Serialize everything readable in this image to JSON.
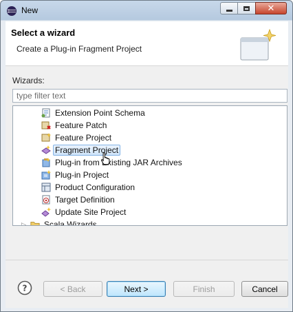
{
  "window": {
    "title": "New"
  },
  "header": {
    "title": "Select a wizard",
    "subtitle": "Create a Plug-in Fragment Project"
  },
  "wizards": {
    "label": "Wizards:",
    "filter_placeholder": "type filter text",
    "items": [
      {
        "label": "Extension Point Schema",
        "icon": "extension-point-schema-icon"
      },
      {
        "label": "Feature Patch",
        "icon": "feature-patch-icon"
      },
      {
        "label": "Feature Project",
        "icon": "feature-project-icon"
      },
      {
        "label": "Fragment Project",
        "icon": "fragment-project-icon",
        "selected": true
      },
      {
        "label": "Plug-in from Existing JAR Archives",
        "icon": "plugin-jar-icon"
      },
      {
        "label": "Plug-in Project",
        "icon": "plugin-project-icon"
      },
      {
        "label": "Product Configuration",
        "icon": "product-configuration-icon"
      },
      {
        "label": "Target Definition",
        "icon": "target-definition-icon"
      },
      {
        "label": "Update Site Project",
        "icon": "update-site-project-icon"
      }
    ],
    "folder_below": "Scala Wizards"
  },
  "buttons": {
    "back": "< Back",
    "next": "Next >",
    "finish": "Finish",
    "cancel": "Cancel"
  }
}
